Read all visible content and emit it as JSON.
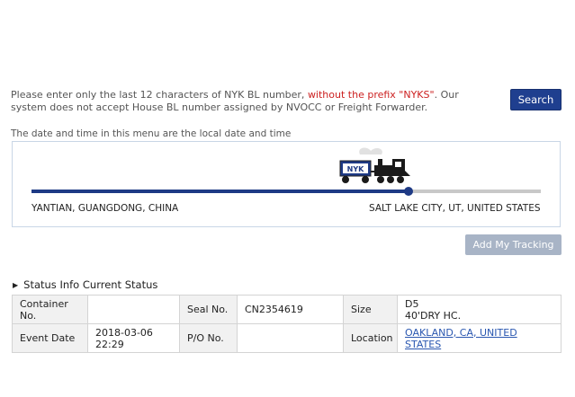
{
  "instructions": {
    "part1": "Please enter only the last 12 characters of NYK BL number, ",
    "highlight": "without the prefix \"NYKS\"",
    "part2": ". Our system does not accept House BL number assigned by NVOCC or Freight Forwarder."
  },
  "search_button": "Search",
  "local_time_note": "The date and time in this menu are the local date and time",
  "route": {
    "origin": "YANTIAN, GUANGDONG, CHINA",
    "destination": "SALT LAKE CITY, UT, UNITED STATES",
    "progress": 0.74,
    "train_label": "NYK"
  },
  "add_tracking_button": "Add My Tracking",
  "status_heading": "Status Info Current Status",
  "status_table": {
    "container_no_label": "Container No.",
    "container_no_value": "",
    "seal_no_label": "Seal No.",
    "seal_no_value": "CN2354619",
    "size_label": "Size",
    "size_value_line1": "D5",
    "size_value_line2": "40'DRY HC.",
    "event_date_label": "Event Date",
    "event_date_line1": "2018-03-06",
    "event_date_line2": "22:29",
    "po_no_label": "P/O No.",
    "po_no_value": "",
    "location_label": "Location",
    "location_value": "OAKLAND, CA, UNITED STATES"
  },
  "colors": {
    "primary": "#1e3a85",
    "highlight_red": "#cc1f1f",
    "disabled_button": "#a8b4c6",
    "link": "#2a57b0"
  }
}
